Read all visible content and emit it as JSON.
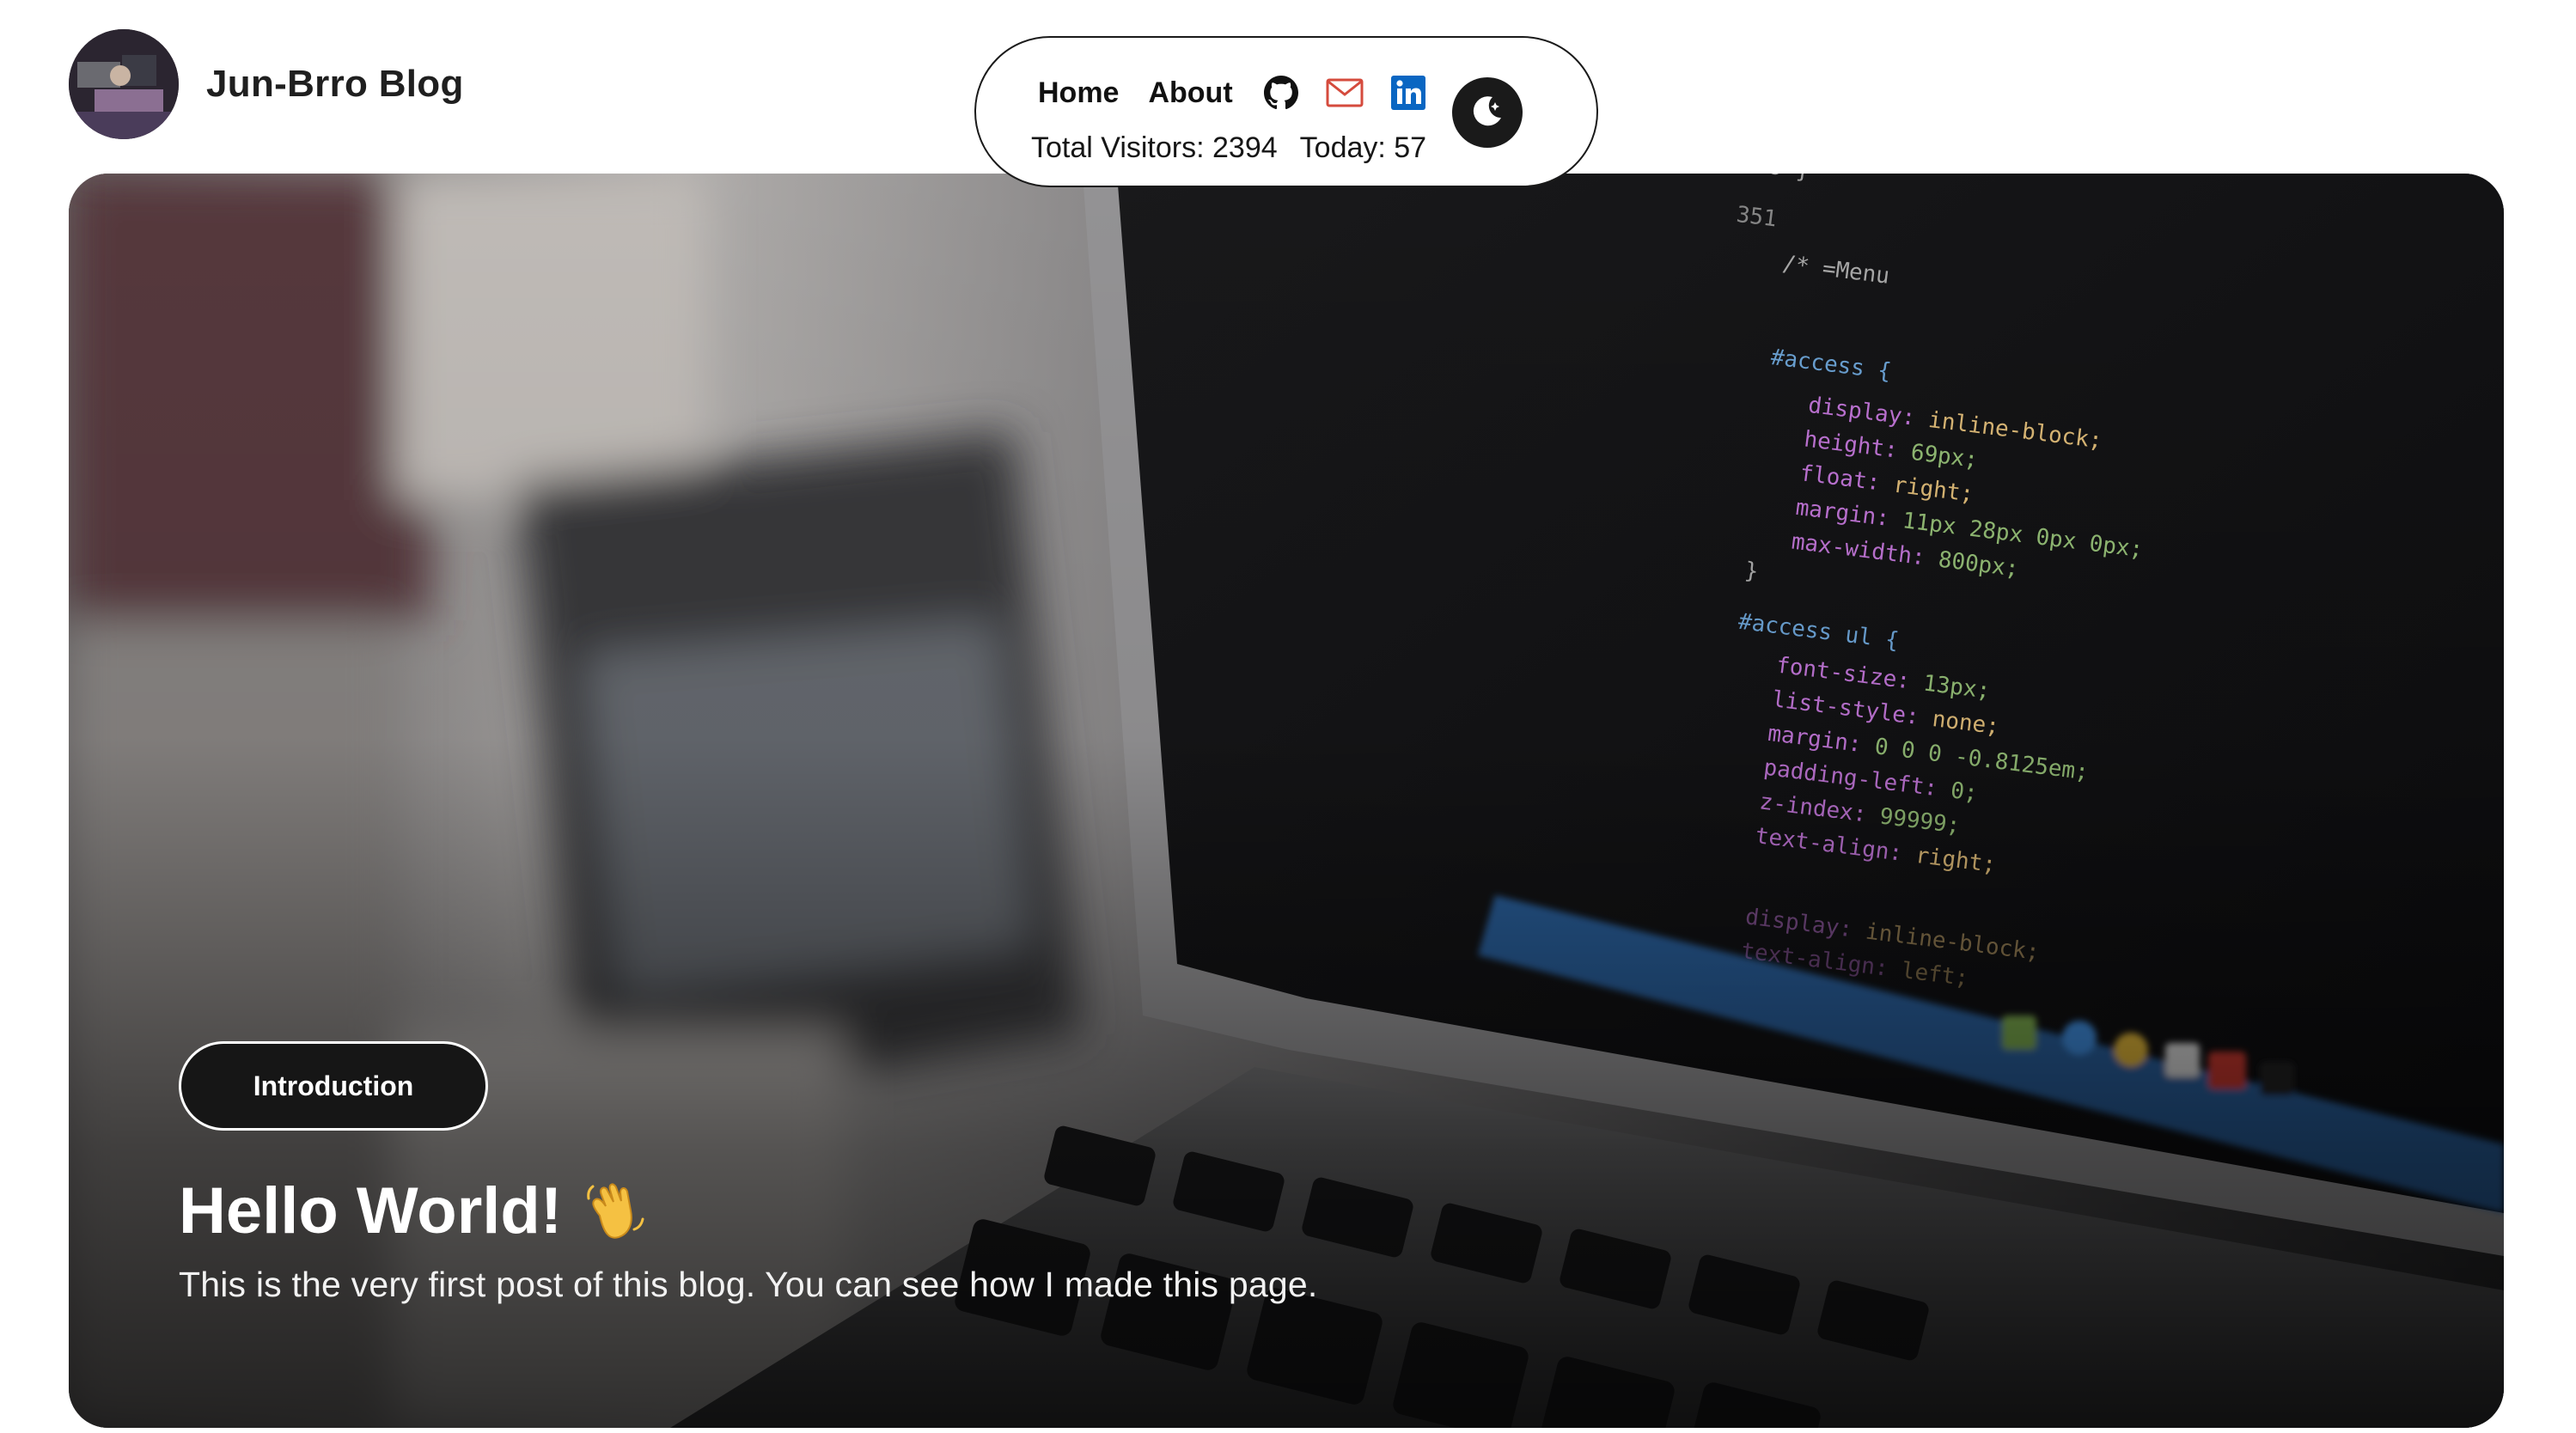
{
  "site": {
    "title": "Jun-Brro Blog",
    "avatar_icon": "profile-photo"
  },
  "nav": {
    "links": [
      {
        "label": "Home"
      },
      {
        "label": "About"
      }
    ],
    "social_icons": [
      "github-icon",
      "mail-icon",
      "linkedin-icon"
    ],
    "visitors": {
      "total": "Total Visitors: 2394",
      "today": "Today: 57"
    },
    "theme_toggle_icon": "moon-star-icon"
  },
  "hero": {
    "tag": "Introduction",
    "title": "Hello World!",
    "title_emoji": "waving-hand-icon",
    "excerpt": "This is the very first post of this blog. You can see how I made this page."
  },
  "colors": {
    "mail_red": "#d54b3d",
    "linkedin_blue": "#0a66c2",
    "dark": "#1a1a1a"
  }
}
